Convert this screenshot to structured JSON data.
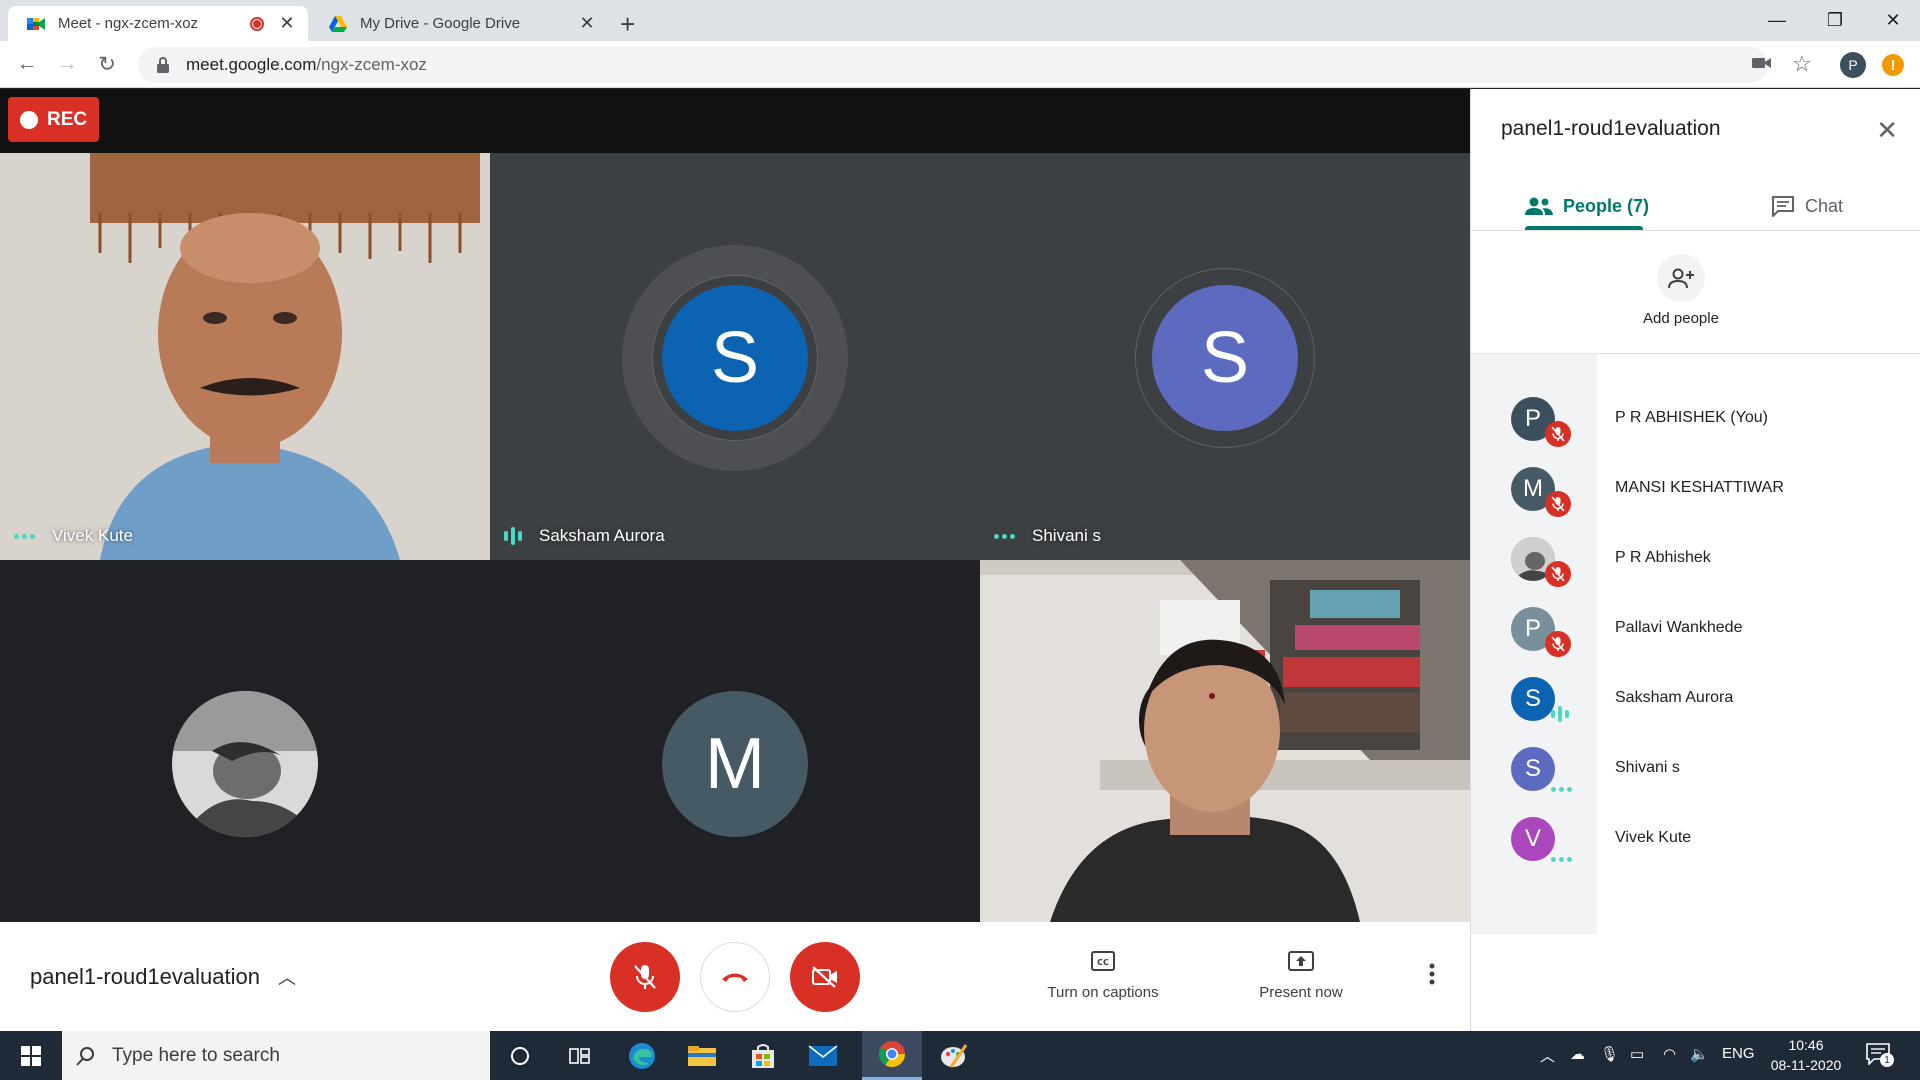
{
  "browser": {
    "tabs": [
      {
        "title": "Meet - ngx-zcem-xoz",
        "recording": true
      },
      {
        "title": "My Drive - Google Drive"
      }
    ],
    "new_tab_glyph": "+",
    "url_host": "meet.google.com",
    "url_path": "/ngx-zcem-xoz",
    "profile_initial": "P",
    "update_glyph": "!"
  },
  "meeting": {
    "rec_label": "REC",
    "tiles": [
      {
        "name": "Vivek Kute",
        "type": "video",
        "status": "dots"
      },
      {
        "name": "Saksham Aurora",
        "type": "avatar",
        "initial": "S",
        "color": "#0b63b1",
        "status": "speaking"
      },
      {
        "name": "Shivani s",
        "type": "avatar",
        "initial": "S",
        "color": "#5c6bc0",
        "status": "dots"
      },
      {
        "name": "",
        "type": "photo-avatar"
      },
      {
        "name": "",
        "type": "avatar",
        "initial": "M",
        "color": "#455a64"
      },
      {
        "name": "",
        "type": "video"
      }
    ]
  },
  "controls": {
    "meeting_name": "panel1-roud1evaluation",
    "captions_label": "Turn on captions",
    "present_label": "Present now",
    "colors": {
      "danger": "#d93025"
    }
  },
  "panel": {
    "title": "panel1-roud1evaluation",
    "tab_people": "People (7)",
    "tab_chat": "Chat",
    "add_people": "Add people",
    "accent": "#00796b",
    "participants": [
      {
        "name": "P R ABHISHEK (You)",
        "initial": "P",
        "color": "#3c4f5c",
        "status": "muted"
      },
      {
        "name": "MANSI KESHATTIWAR",
        "initial": "M",
        "color": "#455a64",
        "status": "muted"
      },
      {
        "name": "P R Abhishek",
        "initial": "",
        "color": "#9e9e9e",
        "status": "muted",
        "photo": true
      },
      {
        "name": "Pallavi Wankhede",
        "initial": "P",
        "color": "#78909c",
        "status": "muted"
      },
      {
        "name": "Saksham Aurora",
        "initial": "S",
        "color": "#0b63b1",
        "status": "speaking"
      },
      {
        "name": "Shivani s",
        "initial": "S",
        "color": "#5c6bc0",
        "status": "dots"
      },
      {
        "name": "Vivek Kute",
        "initial": "V",
        "color": "#ab47bc",
        "status": "dots"
      }
    ]
  },
  "taskbar": {
    "search_placeholder": "Type here to search",
    "language": "ENG",
    "time": "10:46",
    "date": "08-11-2020",
    "notifications": "1"
  }
}
